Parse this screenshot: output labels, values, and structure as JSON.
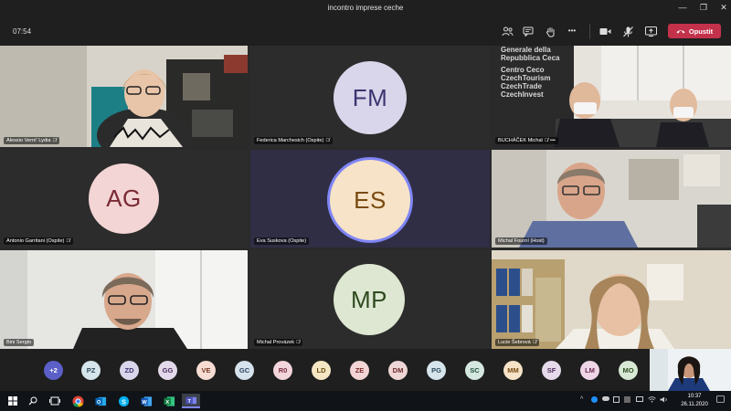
{
  "window": {
    "title": "incontro imprese ceche",
    "minimize": "—",
    "maximize": "❐",
    "close": "✕"
  },
  "toolbar": {
    "timer": "07:54",
    "leave_label": "Opustit",
    "more": "•••"
  },
  "tiles": [
    {
      "name": "Alessio Vernì' Lydia",
      "type": "video"
    },
    {
      "name": "Federica Marchesich (Ospite)",
      "type": "avatar",
      "initials": "FM",
      "bg": "#d9d5ea",
      "fg": "#3a3570"
    },
    {
      "name": "BUCHÁČEK Michal",
      "type": "video",
      "more": "•••"
    },
    {
      "name": "Antonio Garritani (Ospite)",
      "type": "avatar",
      "initials": "AG",
      "bg": "#f3d5d5",
      "fg": "#7a2a34"
    },
    {
      "name": "Eva Suskova (Ospite)",
      "type": "avatar",
      "initials": "ES",
      "bg": "#f6e3c8",
      "fg": "#7a4a10",
      "speaking": true
    },
    {
      "name": "Michal Fourní (Host)",
      "type": "video"
    },
    {
      "name": "Bini Sergio",
      "type": "video"
    },
    {
      "name": "Michal Provázek",
      "type": "avatar",
      "initials": "MP",
      "bg": "#dde7d2",
      "fg": "#2f4a1f"
    },
    {
      "name": "Lucie Šebrová",
      "type": "video"
    }
  ],
  "banner_text": [
    "Generale della",
    "Repubblica Ceca",
    "Centro Ceco",
    "CzechTourism",
    "CzechTrade",
    "CzechInvest"
  ],
  "overflow": {
    "label": "+2",
    "bg": "#5b5fc7",
    "fg": "#ffffff"
  },
  "participants": [
    {
      "initials": "PZ",
      "bg": "#d6e4ec",
      "fg": "#2c4a5a"
    },
    {
      "initials": "ZD",
      "bg": "#d9d5ea",
      "fg": "#3a3570"
    },
    {
      "initials": "GG",
      "bg": "#e3d9ea",
      "fg": "#4a2f60"
    },
    {
      "initials": "VE",
      "bg": "#f6dcd2",
      "fg": "#7a3a24"
    },
    {
      "initials": "GC",
      "bg": "#d6e2ec",
      "fg": "#2c4460"
    },
    {
      "initials": "R0",
      "bg": "#f3d5dc",
      "fg": "#7a2a3e"
    },
    {
      "initials": "LD",
      "bg": "#f6e7c4",
      "fg": "#6a4a10"
    },
    {
      "initials": "ZE",
      "bg": "#f3d5d5",
      "fg": "#7a2a2a"
    },
    {
      "initials": "DM",
      "bg": "#efd6d6",
      "fg": "#6e2a2a"
    },
    {
      "initials": "PG",
      "bg": "#d6e4ec",
      "fg": "#2c4a5a"
    },
    {
      "initials": "SC",
      "bg": "#d5e8df",
      "fg": "#235040"
    },
    {
      "initials": "MM",
      "bg": "#f6e3c8",
      "fg": "#7a4a10"
    },
    {
      "initials": "SF",
      "bg": "#e6d9ea",
      "fg": "#4e2f60"
    },
    {
      "initials": "LM",
      "bg": "#efd6e6",
      "fg": "#6a2a50"
    },
    {
      "initials": "MO",
      "bg": "#d7e8d4",
      "fg": "#2f5020"
    }
  ],
  "taskbar": {
    "clock_time": "10:37",
    "clock_date": "26.11.2020",
    "tray_arrow": "^"
  },
  "colors": {
    "accent": "#5b5fc7",
    "leave": "#c4314b"
  }
}
